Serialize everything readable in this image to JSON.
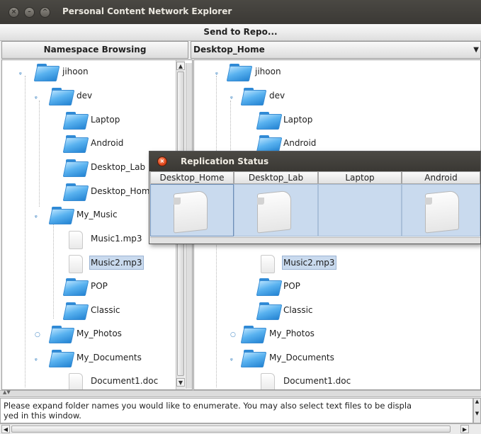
{
  "window": {
    "title": "Personal Content Network Explorer"
  },
  "toolbar": {
    "send_label": "Send to Repo..."
  },
  "left_header": {
    "label": "Namespace Browsing"
  },
  "right_header": {
    "label": "Desktop_Home"
  },
  "tree_left": {
    "root": "jihoon",
    "dev": "dev",
    "laptop": "Laptop",
    "android": "Android",
    "desktop_lab": "Desktop_Lab",
    "desktop_home": "Desktop_Home",
    "my_music": "My_Music",
    "music1": "Music1.mp3",
    "music2": "Music2.mp3",
    "pop": "POP",
    "classic": "Classic",
    "my_photos": "My_Photos",
    "my_documents": "My_Documents",
    "document1": "Document1.doc"
  },
  "tree_right": {
    "root": "jihoon",
    "dev": "dev",
    "laptop": "Laptop",
    "android": "Android",
    "music2": "Music2.mp3",
    "pop": "POP",
    "classic": "Classic",
    "my_photos": "My_Photos",
    "my_documents": "My_Documents",
    "document1": "Document1.doc"
  },
  "replication_dialog": {
    "title": "Replication Status",
    "columns": [
      "Desktop_Home",
      "Desktop_Lab",
      "Laptop",
      "Android"
    ],
    "has_file": [
      true,
      true,
      false,
      true
    ]
  },
  "message": {
    "line1": "Please expand folder names you would like to enumerate.  You may also select text files to be displa",
    "line2": "yed in this window."
  },
  "icons": {
    "folder": "folder-icon",
    "file": "file-icon",
    "expand": "expand-handle-icon",
    "close": "close-icon"
  },
  "colors": {
    "titlebar": "#3f3d39",
    "selection": "#c9daee",
    "folder": "#3b96e0",
    "close_button": "#e0461b"
  }
}
